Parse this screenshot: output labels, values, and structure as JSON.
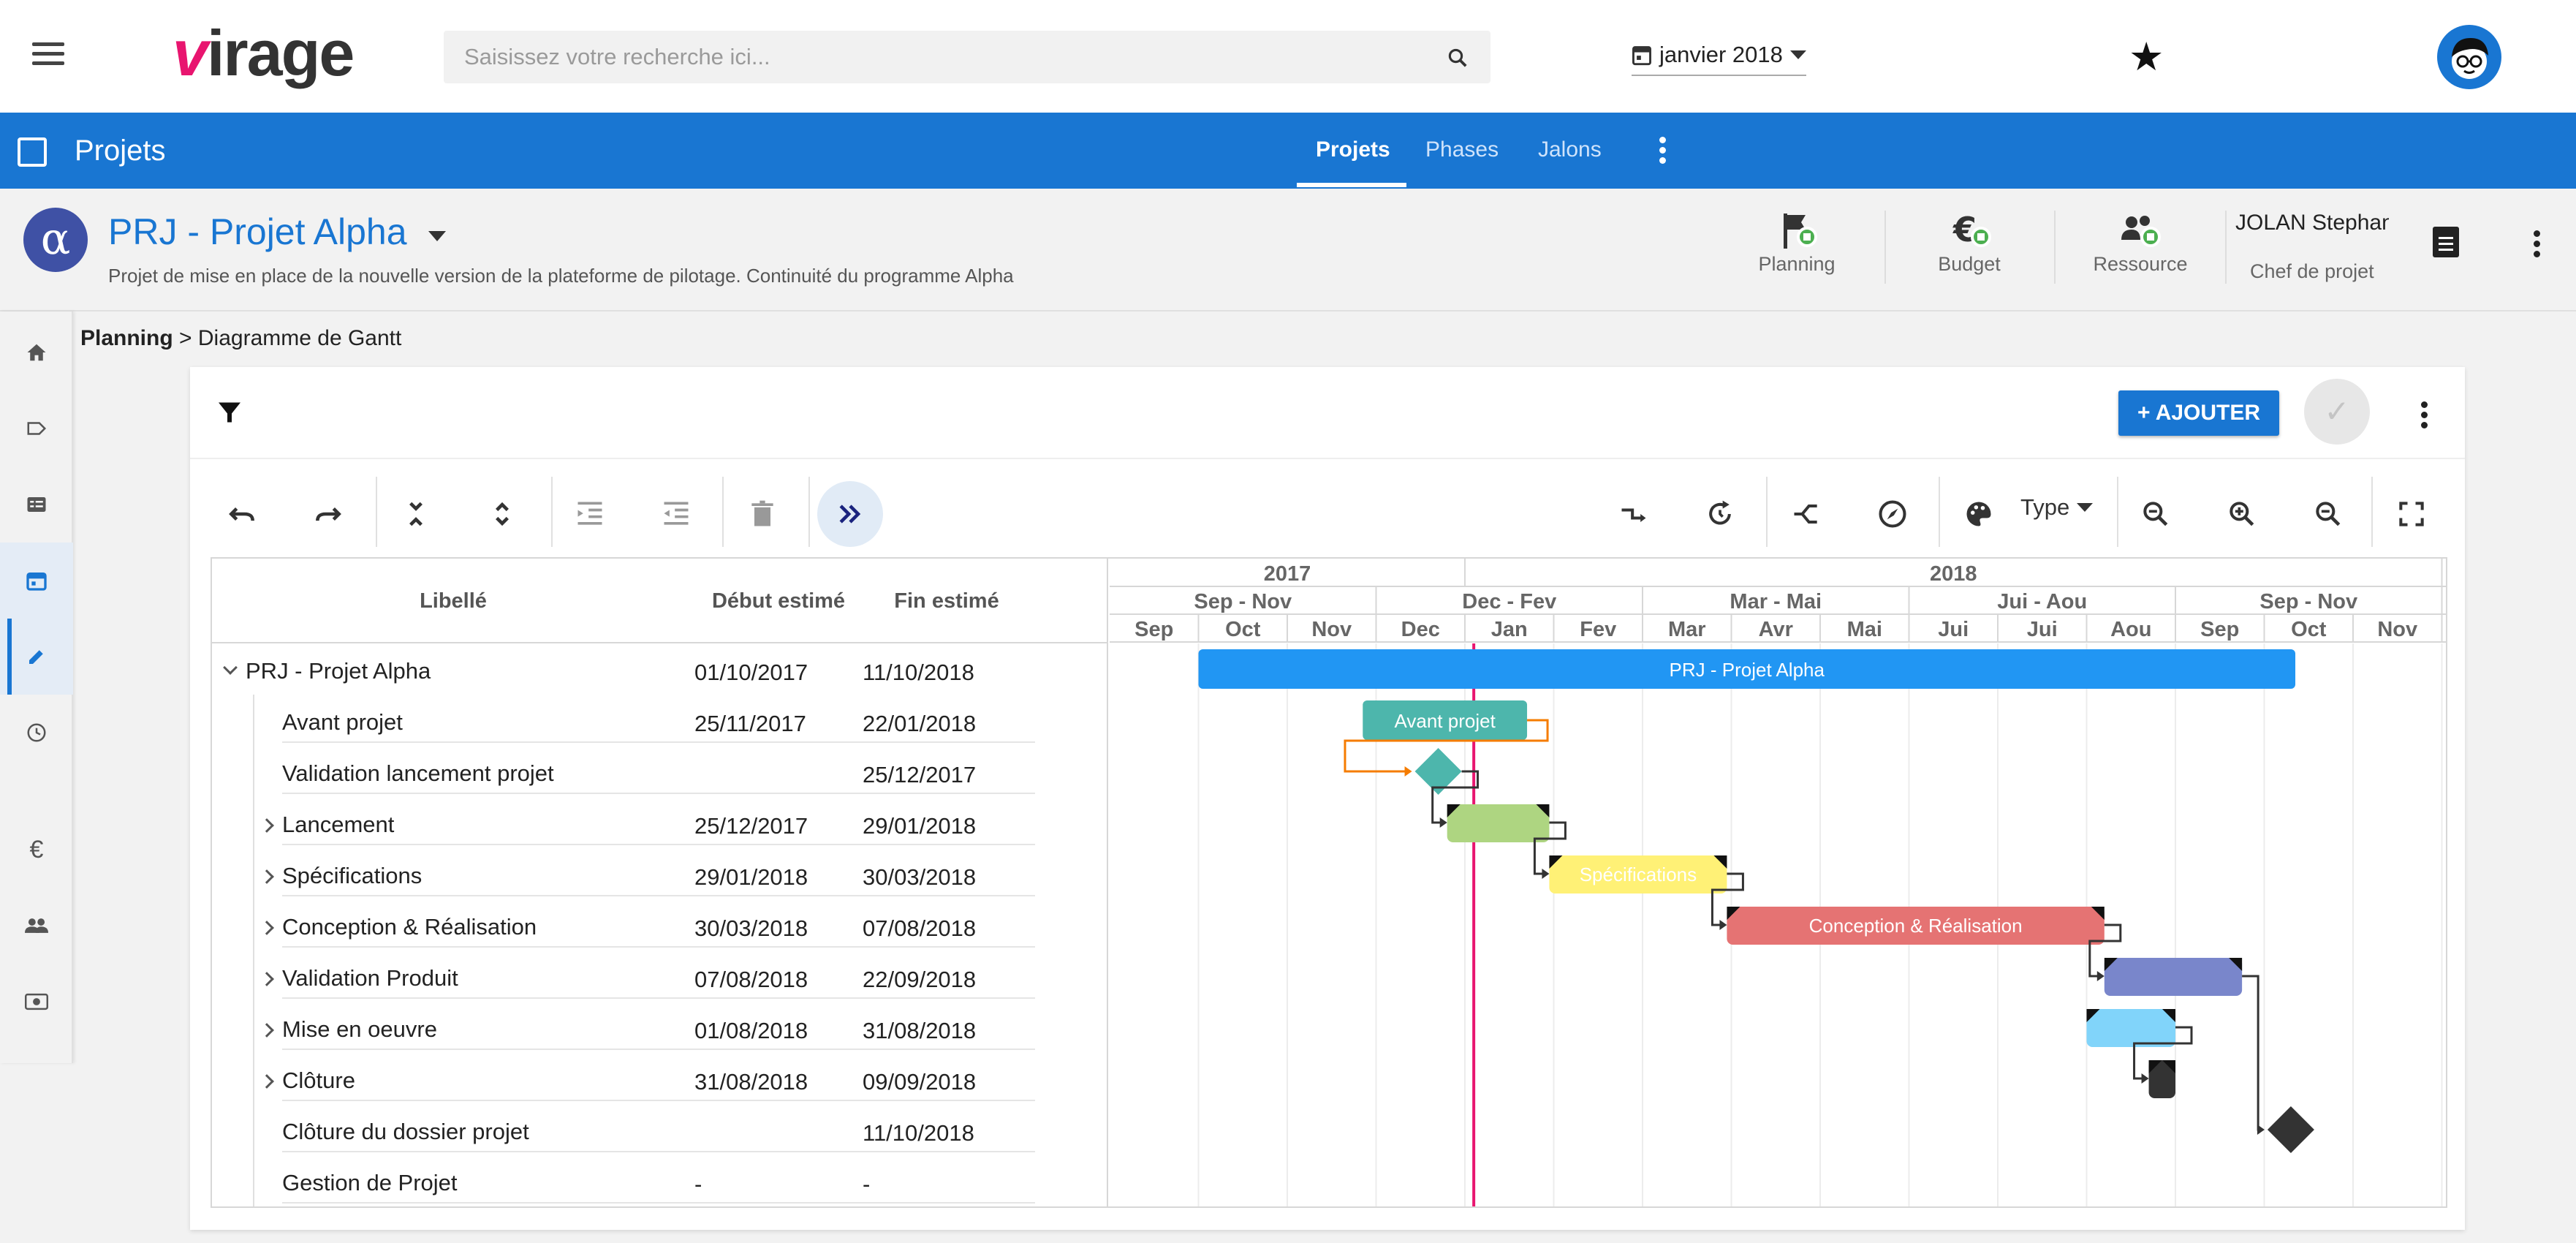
{
  "topbar": {
    "logo_v": "v",
    "logo_rest": "irage",
    "search_placeholder": "Saisissez votre recherche ici...",
    "date": "janvier 2018"
  },
  "bluebar": {
    "title": "Projets",
    "tabs": [
      {
        "label": "Projets",
        "active": true
      },
      {
        "label": "Phases",
        "active": false
      },
      {
        "label": "Jalons",
        "active": false
      }
    ]
  },
  "project": {
    "icon": "α",
    "name": "PRJ - Projet Alpha",
    "description": "Projet de mise en place de la nouvelle version de la plateforme de pilotage. Continuité du programme Alpha",
    "kpis": [
      {
        "label": "Planning",
        "icon": "flag-icon",
        "status_color": "#4caf50"
      },
      {
        "label": "Budget",
        "icon": "euro-icon",
        "status_color": "#4caf50"
      },
      {
        "label": "Ressource",
        "icon": "people-icon",
        "status_color": "#4caf50"
      }
    ],
    "manager_name": "JOLAN Stephane",
    "manager_role": "Chef de projet"
  },
  "breadcrumb": {
    "root": "Planning",
    "separator": ">",
    "current": "Diagramme de Gantt"
  },
  "toolbar": {
    "add_label": "+ AJOUTER",
    "check": "✓",
    "type_label": "Type"
  },
  "grid": {
    "headers": {
      "label": "Libellé",
      "start": "Début estimé",
      "end": "Fin estimé"
    },
    "rows": [
      {
        "label": "PRJ - Projet Alpha",
        "start": "01/10/2017",
        "end": "11/10/2018",
        "level": 0,
        "expand": "open"
      },
      {
        "label": "Avant projet",
        "start": "25/11/2017",
        "end": "22/01/2018",
        "level": 1,
        "expand": "none"
      },
      {
        "label": "Validation lancement projet",
        "start": "",
        "end": "25/12/2017",
        "level": 1,
        "expand": "none"
      },
      {
        "label": "Lancement",
        "start": "25/12/2017",
        "end": "29/01/2018",
        "level": 1,
        "expand": "closed"
      },
      {
        "label": "Spécifications",
        "start": "29/01/2018",
        "end": "30/03/2018",
        "level": 1,
        "expand": "closed"
      },
      {
        "label": "Conception & Réalisation",
        "start": "30/03/2018",
        "end": "07/08/2018",
        "level": 1,
        "expand": "closed"
      },
      {
        "label": "Validation Produit",
        "start": "07/08/2018",
        "end": "22/09/2018",
        "level": 1,
        "expand": "closed"
      },
      {
        "label": "Mise en oeuvre",
        "start": "01/08/2018",
        "end": "31/08/2018",
        "level": 1,
        "expand": "closed"
      },
      {
        "label": "Clôture",
        "start": "31/08/2018",
        "end": "09/09/2018",
        "level": 1,
        "expand": "closed"
      },
      {
        "label": "Clôture du dossier projet",
        "start": "",
        "end": "11/10/2018",
        "level": 1,
        "expand": "none"
      },
      {
        "label": "Gestion de Projet",
        "start": "-",
        "end": "-",
        "level": 1,
        "expand": "none"
      }
    ]
  },
  "timeline": {
    "years": [
      {
        "label": "2017",
        "span": 4
      },
      {
        "label": "2018",
        "span": 11
      }
    ],
    "quarters": [
      {
        "label": "Sep - Nov",
        "span": 3
      },
      {
        "label": "Dec - Fev",
        "span": 3
      },
      {
        "label": "Mar - Mai",
        "span": 3
      },
      {
        "label": "Jui - Aou",
        "span": 3
      },
      {
        "label": "Sep - Nov",
        "span": 3
      }
    ],
    "months": [
      "Sep",
      "Oct",
      "Nov",
      "Dec",
      "Jan",
      "Fev",
      "Mar",
      "Avr",
      "Mai",
      "Jui",
      "Jui",
      "Aou",
      "Sep",
      "Oct",
      "Nov"
    ],
    "today_month_index": 4.1,
    "today_color": "#e8156f"
  },
  "chart_data": {
    "type": "gantt",
    "start_month_index_origin": "Sep 2017",
    "tasks": [
      {
        "name": "PRJ - Projet Alpha",
        "kind": "bar",
        "start": 1.0,
        "end": 13.35,
        "color": "#2196f3",
        "label": "PRJ - Projet Alpha"
      },
      {
        "name": "Avant projet",
        "kind": "bar",
        "start": 2.85,
        "end": 4.7,
        "color": "#4db6ac",
        "label": "Avant projet"
      },
      {
        "name": "Validation lancement projet",
        "kind": "milestone",
        "at": 3.7,
        "color": "#4db6ac"
      },
      {
        "name": "Lancement",
        "kind": "summary",
        "start": 3.8,
        "end": 4.95,
        "color": "#aed581",
        "label": ""
      },
      {
        "name": "Spécifications",
        "kind": "summary",
        "start": 4.95,
        "end": 6.95,
        "color": "#fff176",
        "label": "Spécifications"
      },
      {
        "name": "Conception & Réalisation",
        "kind": "summary",
        "start": 6.95,
        "end": 11.2,
        "color": "#e57373",
        "label": "Conception & Réalisation"
      },
      {
        "name": "Validation Produit",
        "kind": "summary",
        "start": 11.2,
        "end": 12.75,
        "color": "#7986cb",
        "label": ""
      },
      {
        "name": "Mise en oeuvre",
        "kind": "summary",
        "start": 11.0,
        "end": 12.0,
        "color": "#81d4fa",
        "label": ""
      },
      {
        "name": "Clôture",
        "kind": "summary",
        "start": 11.7,
        "end": 12.0,
        "color": "#333333",
        "label": ""
      },
      {
        "name": "Clôture du dossier projet",
        "kind": "milestone",
        "at": 13.3,
        "color": "#333333"
      }
    ]
  }
}
